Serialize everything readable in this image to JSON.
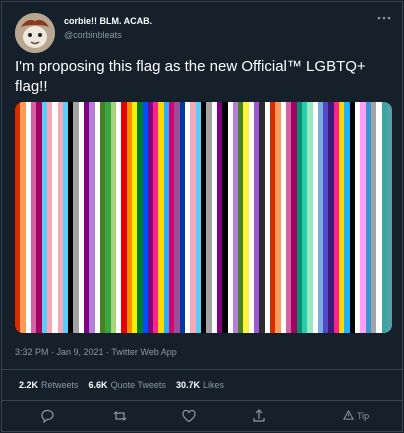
{
  "tweet": {
    "display_name": "corbie!! BLM. ACAB.",
    "handle": "@corbinbleats",
    "text": "I'm proposing this flag as the new Official™ LGBTQ+ flag!!",
    "timestamp": "3:32 PM · Jan 9, 2021 · Twitter Web App",
    "more_icon": "more-horizontal-icon"
  },
  "stats": {
    "retweets_count": "2.2K",
    "retweets_label": "Retweets",
    "quotes_count": "6.6K",
    "quotes_label": "Quote Tweets",
    "likes_count": "30.7K",
    "likes_label": "Likes"
  },
  "actions": {
    "reply_icon": "reply-icon",
    "retweet_icon": "retweet-icon",
    "like_icon": "heart-icon",
    "share_icon": "share-icon",
    "tip_label": "Tip"
  },
  "flag": {
    "stripes": [
      "#d52d00",
      "#ff9a56",
      "#ffffff",
      "#d362a4",
      "#a30262",
      "#5bcefa",
      "#f5a9b8",
      "#ffffff",
      "#f5a9b8",
      "#5bcefa",
      "#000000",
      "#a3a3a3",
      "#ffffff",
      "#800080",
      "#b57edc",
      "#ffffff",
      "#4a8123",
      "#3aa63f",
      "#a8d47a",
      "#ffffff",
      "#e40303",
      "#ff8c00",
      "#ffed00",
      "#008026",
      "#004dff",
      "#750787",
      "#ff218c",
      "#ffd800",
      "#21b1ff",
      "#d60270",
      "#9b4f96",
      "#0038a8",
      "#ffffff",
      "#f5a9b8",
      "#5bcefa",
      "#000000",
      "#a3a3a3",
      "#ffffff",
      "#800080",
      "#000000",
      "#ffffff",
      "#b57edc",
      "#4a8123",
      "#fcf434",
      "#ffffff",
      "#9c59d1",
      "#2c2c2c",
      "#ffffff",
      "#d52d00",
      "#ff9a56",
      "#ffffff",
      "#d362a4",
      "#a30262",
      "#078d70",
      "#26ceaa",
      "#98e8c1",
      "#ffffff",
      "#7bade2",
      "#5049cc",
      "#3d1a78",
      "#ff218c",
      "#ffd800",
      "#21b1ff",
      "#000000",
      "#ffffff",
      "#ff9ff5",
      "#3a96d0",
      "#a3a3a3",
      "#ffffff",
      "#3aa6a0",
      "#55a0a8"
    ]
  },
  "colors": {
    "background": "#15202b",
    "border": "#38444d",
    "muted_text": "#8899a6"
  }
}
